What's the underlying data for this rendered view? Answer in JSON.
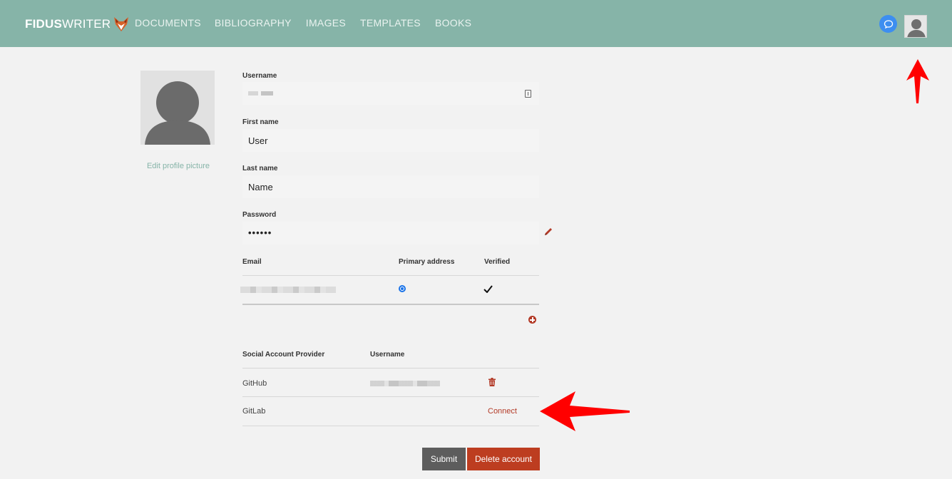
{
  "app": {
    "logo_bold": "FIDUS",
    "logo_light": "WRITER"
  },
  "nav": {
    "items": [
      {
        "label": "DOCUMENTS"
      },
      {
        "label": "BIBLIOGRAPHY"
      },
      {
        "label": "IMAGES"
      },
      {
        "label": "TEMPLATES"
      },
      {
        "label": "BOOKS"
      }
    ]
  },
  "profile": {
    "edit_picture_label": "Edit profile picture"
  },
  "form": {
    "username_label": "Username",
    "first_name_label": "First name",
    "first_name_value": "User",
    "last_name_label": "Last name",
    "last_name_value": "Name",
    "password_label": "Password",
    "password_value": "••••••"
  },
  "email_table": {
    "headers": [
      "Email",
      "Primary address",
      "Verified"
    ]
  },
  "social_table": {
    "headers": [
      "Social Account Provider",
      "Username"
    ],
    "rows": [
      {
        "provider": "GitHub",
        "action": ""
      },
      {
        "provider": "GitLab",
        "action": "Connect"
      }
    ]
  },
  "buttons": {
    "submit": "Submit",
    "delete_account": "Delete account"
  },
  "colors": {
    "header": "#86b4a8",
    "danger": "#bd3d20",
    "link_accent": "#b33a27",
    "chat": "#3d8ef0",
    "annotation": "#ff0000"
  },
  "icons": {
    "chat": "chat-bubble-icon",
    "user": "user-avatar-icon",
    "badge": "id-badge-icon",
    "edit": "pencil-icon",
    "check": "check-icon",
    "add": "plus-circle-icon",
    "delete": "trash-icon",
    "brand": "fox-logo-icon"
  }
}
